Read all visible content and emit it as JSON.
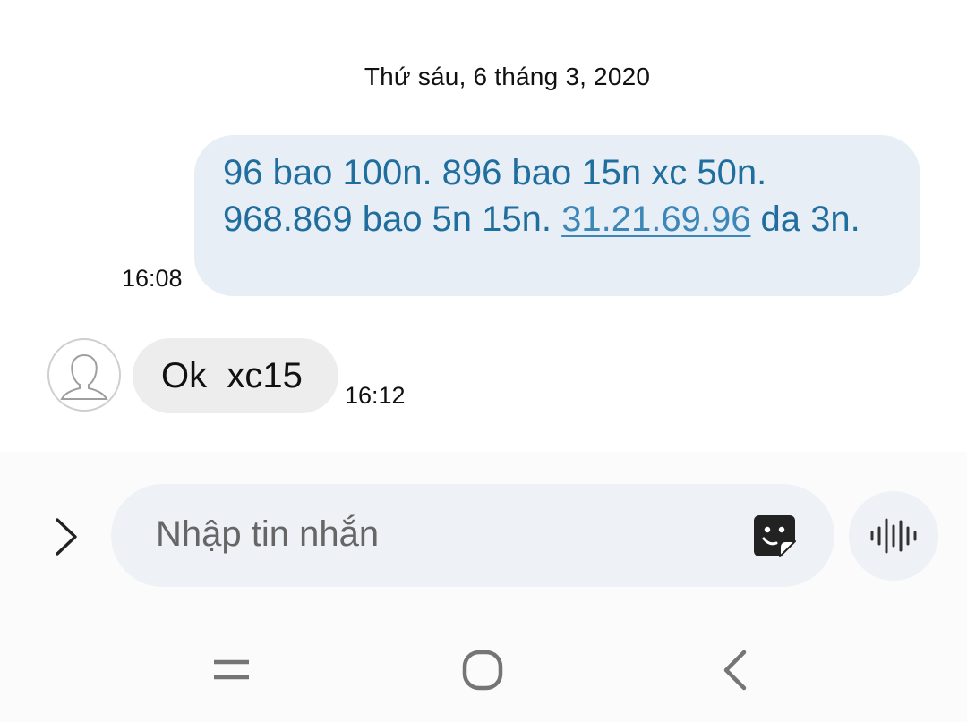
{
  "conversation": {
    "date_header": "Thứ sáu, 6 tháng 3, 2020"
  },
  "messages": [
    {
      "direction": "sent",
      "text_before_link": "96 bao 100n. 896 bao 15n xc 50n. 968.869 bao 5n 15n. ",
      "link_text": "31.21.69.96",
      "text_after_link": " da 3n.",
      "time": "16:08"
    },
    {
      "direction": "received",
      "text": "Ok  xc15",
      "time": "16:12"
    }
  ],
  "composer": {
    "placeholder": "Nhập tin nhắn"
  },
  "icons": {
    "expand": "chevron-right-icon",
    "avatar": "default-person-icon",
    "sticker": "sticker-icon",
    "voice": "voice-waveform-icon",
    "recents": "recent-apps-icon",
    "home": "home-icon",
    "back": "back-icon"
  },
  "colors": {
    "sent_bubble": "#e8eef6",
    "sent_text": "#1f6e9e",
    "link": "#3a87b8",
    "received_bubble": "#ededed",
    "composer_field": "#eef2f7",
    "icon_gray": "#757575"
  }
}
